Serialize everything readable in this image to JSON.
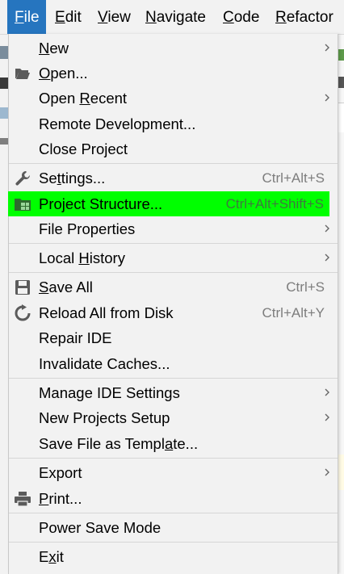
{
  "menubar": [
    {
      "pre": "",
      "mn": "F",
      "post": "ile",
      "active": true
    },
    {
      "pre": "",
      "mn": "E",
      "post": "dit"
    },
    {
      "pre": "",
      "mn": "V",
      "post": "iew"
    },
    {
      "pre": "",
      "mn": "N",
      "post": "avigate"
    },
    {
      "pre": "",
      "mn": "C",
      "post": "ode"
    },
    {
      "pre": "",
      "mn": "R",
      "post": "efactor"
    }
  ],
  "menu": {
    "items": [
      {
        "pre": "",
        "mn": "N",
        "post": "ew",
        "submenu": true
      },
      {
        "pre": "",
        "mn": "O",
        "post": "pen...",
        "icon": "folder-open-icon"
      },
      {
        "pre": "Open ",
        "mn": "R",
        "post": "ecent",
        "submenu": true
      },
      {
        "pre": "Remote Development...",
        "mn": "",
        "post": ""
      },
      {
        "pre": "Close Project",
        "mn": "",
        "post": ""
      },
      {
        "pre": "Se",
        "mn": "t",
        "post": "tings...",
        "icon": "wrench-icon",
        "shortcut": "Ctrl+Alt+S"
      },
      {
        "pre": "Project Structure...",
        "mn": "",
        "post": "",
        "icon": "project-structure-icon",
        "shortcut": "Ctrl+Alt+Shift+S",
        "highlighted": true
      },
      {
        "pre": "File Properties",
        "mn": "",
        "post": "",
        "submenu": true
      },
      {
        "pre": "Local ",
        "mn": "H",
        "post": "istory",
        "submenu": true
      },
      {
        "pre": "",
        "mn": "S",
        "post": "ave All",
        "icon": "save-icon",
        "shortcut": "Ctrl+S"
      },
      {
        "pre": "Reload All from Disk",
        "mn": "",
        "post": "",
        "icon": "reload-icon",
        "shortcut": "Ctrl+Alt+Y"
      },
      {
        "pre": "Repair IDE",
        "mn": "",
        "post": ""
      },
      {
        "pre": "Invalidate Caches...",
        "mn": "",
        "post": ""
      },
      {
        "pre": "Manage IDE Settings",
        "mn": "",
        "post": "",
        "submenu": true
      },
      {
        "pre": "New Projects Setup",
        "mn": "",
        "post": "",
        "submenu": true
      },
      {
        "pre": "Save File as Templ",
        "mn": "a",
        "post": "te..."
      },
      {
        "pre": "Export",
        "mn": "",
        "post": "",
        "submenu": true
      },
      {
        "pre": "",
        "mn": "P",
        "post": "rint...",
        "icon": "printer-icon"
      },
      {
        "pre": "Power Save Mode",
        "mn": "",
        "post": ""
      },
      {
        "pre": "E",
        "mn": "x",
        "post": "it"
      }
    ]
  },
  "colors": {
    "menu_bg": "#f2f2f2",
    "menubar_active": "#2675bf",
    "highlight": "#00ff00",
    "shortcut_text": "#7d7d7d"
  }
}
